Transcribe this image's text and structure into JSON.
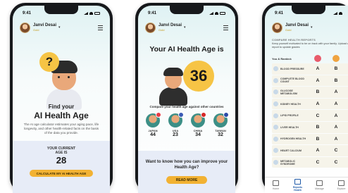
{
  "status": {
    "time": "9:41"
  },
  "user": {
    "name": "Janvi Desai",
    "badge": "Gold"
  },
  "phone1": {
    "bubble": "?",
    "find": "Find your",
    "title": "AI Health Age",
    "description": "The AI age calculator estimates your aging pace, life longevity, and other health-related facts on the basis of the data you provide.",
    "current_label_1": "YOUR CURRENT",
    "current_label_2": "AGE IS",
    "current_age": "28",
    "button": "CALCULATE MY AI HEALTH AGE"
  },
  "phone2": {
    "title": "Your AI Health Age is",
    "age": "36",
    "compare": "Compare your health age against other countries",
    "countries": [
      {
        "name": "JAPAN",
        "value": "44",
        "flag_color": "#e73b45"
      },
      {
        "name": "USA",
        "value": "23",
        "flag_color": "#3b5bb5"
      },
      {
        "name": "CHINA",
        "value": "34",
        "flag_color": "#d62828"
      },
      {
        "name": "TAIWAN",
        "value": "32",
        "flag_color": "#2b4ba8"
      }
    ],
    "question": "Want to know how you can improve your Health Age?",
    "button": "READ MORE"
  },
  "phone3": {
    "section": "COMPARE HEALTH REPORTS",
    "note": "Keep yourself motivated to be on track with your family. Upload a report to update grades",
    "col_label": "You & Rankick",
    "rows": [
      {
        "label": "BLOOD PRESSURE",
        "a": "A",
        "b": "B"
      },
      {
        "label": "COMPLETE BLOOD COUNT",
        "a": "A",
        "b": "B"
      },
      {
        "label": "GLUCOSE METABOLISM",
        "a": "B",
        "b": "A"
      },
      {
        "label": "KIDNEY HEALTH",
        "a": "A",
        "b": "A"
      },
      {
        "label": "LIPID PROFILE",
        "a": "C",
        "b": "A"
      },
      {
        "label": "LIVER HEALTH",
        "a": "B",
        "b": "A"
      },
      {
        "label": "HYDROGEN HEALTH",
        "a": "B",
        "b": "A"
      },
      {
        "label": "HEART CALCIUM",
        "a": "A",
        "b": "C"
      },
      {
        "label": "METABOLIC SYNDROME",
        "a": "C",
        "b": "C"
      }
    ],
    "tabs": [
      {
        "label": "Home"
      },
      {
        "label": "Reports Health"
      },
      {
        "label": "Manage"
      },
      {
        "label": "Explore"
      }
    ]
  }
}
